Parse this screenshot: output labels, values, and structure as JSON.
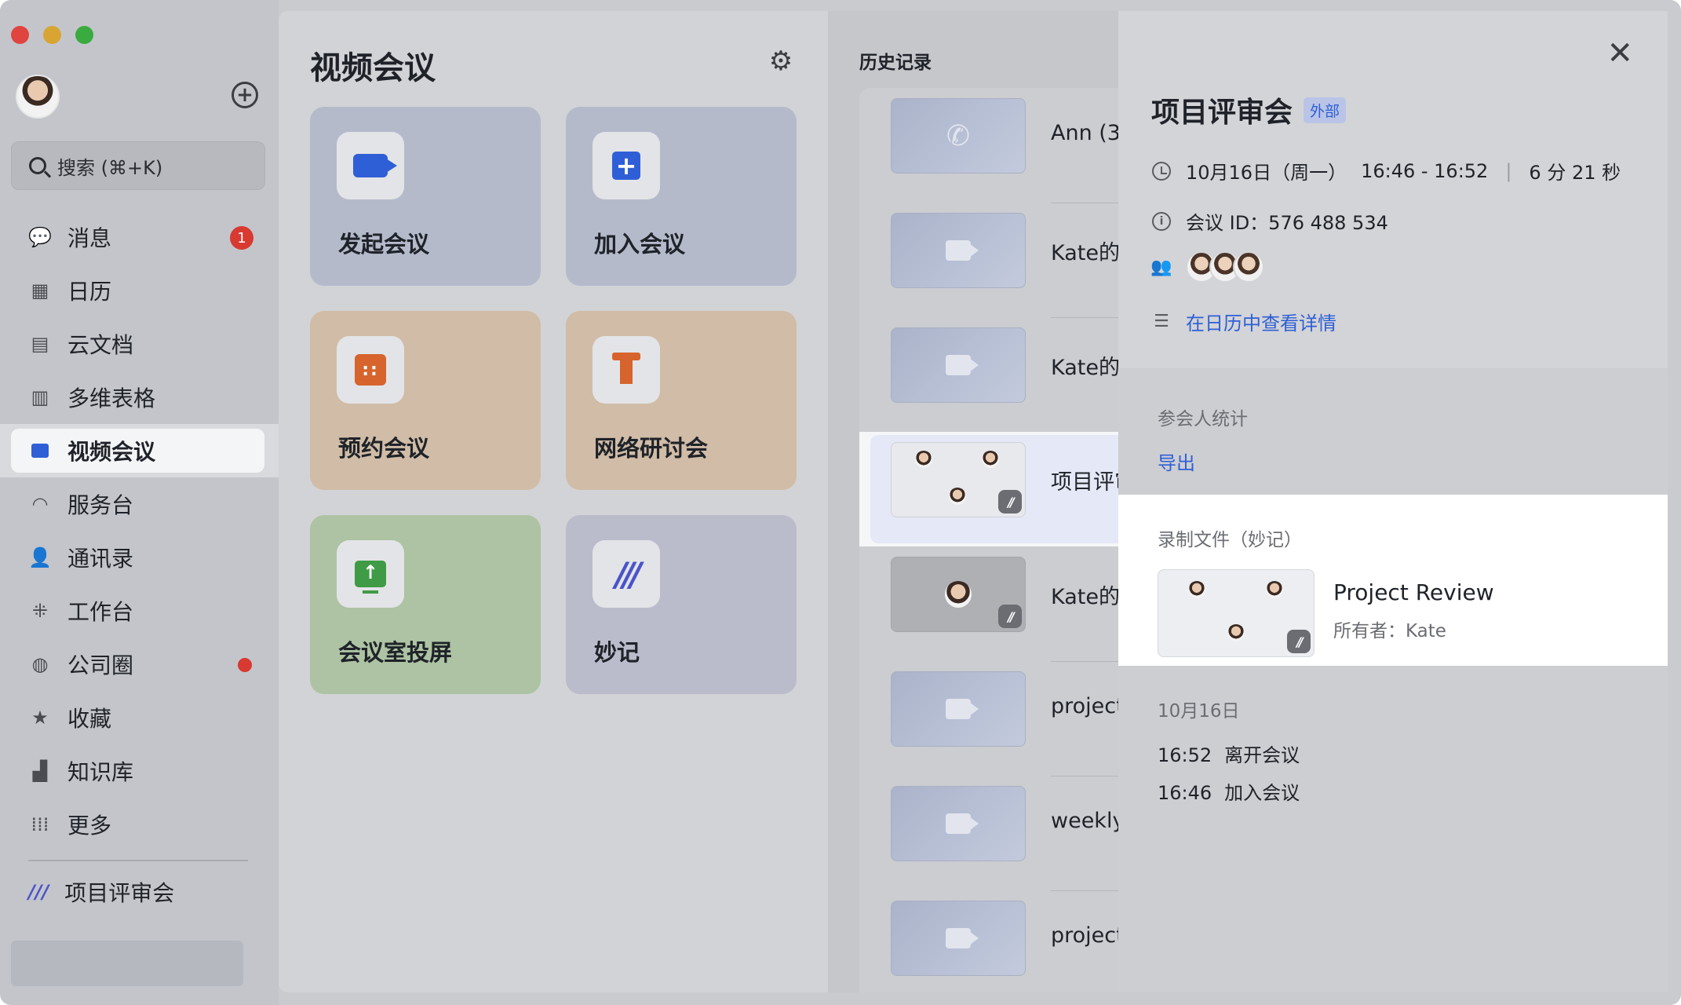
{
  "sidebar": {
    "search_placeholder": "搜索 (⌘+K)",
    "items": [
      {
        "label": "消息",
        "icon": "chat-bubbles-icon",
        "badge": "1"
      },
      {
        "label": "日历",
        "icon": "calendar-icon"
      },
      {
        "label": "云文档",
        "icon": "document-icon"
      },
      {
        "label": "多维表格",
        "icon": "table-icon"
      },
      {
        "label": "视频会议",
        "icon": "video-camera-icon",
        "active": true
      },
      {
        "label": "服务台",
        "icon": "headset-icon"
      },
      {
        "label": "通讯录",
        "icon": "contacts-icon"
      },
      {
        "label": "工作台",
        "icon": "apps-grid-icon"
      },
      {
        "label": "公司圈",
        "icon": "planet-icon",
        "dot": true
      },
      {
        "label": "收藏",
        "icon": "star-icon"
      },
      {
        "label": "知识库",
        "icon": "knowledge-base-icon"
      },
      {
        "label": "更多",
        "icon": "dots-grid-icon"
      }
    ],
    "pinned": {
      "label": "项目评审会",
      "icon": "miaoji-icon"
    }
  },
  "main": {
    "title": "视频会议",
    "cards": [
      {
        "label": "发起会议",
        "icon": "video-camera-icon",
        "color": "#b5bacb"
      },
      {
        "label": "加入会议",
        "icon": "plus-square-icon",
        "color": "#b5bacb"
      },
      {
        "label": "预约会议",
        "icon": "calendar-icon",
        "color": "#d0bca7"
      },
      {
        "label": "网络研讨会",
        "icon": "podium-icon",
        "color": "#d0bca7"
      },
      {
        "label": "会议室投屏",
        "icon": "screen-share-icon",
        "color": "#adc3a3"
      },
      {
        "label": "妙记",
        "icon": "miaoji-icon",
        "color": "#bbbccb"
      }
    ]
  },
  "history": {
    "title": "历史记录",
    "items": [
      {
        "name": "Ann (3"
      },
      {
        "name": "Kate的"
      },
      {
        "name": "Kate的"
      },
      {
        "name": "项目评审"
      },
      {
        "name": "Kate的"
      },
      {
        "name": "project"
      },
      {
        "name": "weekly"
      },
      {
        "name": "project"
      }
    ]
  },
  "detail": {
    "title": "项目评审会",
    "tag": "外部",
    "date": "10月16日（周一）",
    "time": "16:46 - 16:52",
    "duration": "6 分 21 秒",
    "meeting_id": "会议 ID：576 488 534",
    "calendar_link": "在日历中查看详情",
    "stats_label": "参会人统计",
    "export": "导出",
    "recording_label": "录制文件（妙记）",
    "recording_title": "Project Review",
    "recording_owner": "所有者：Kate",
    "log_date": "10月16日",
    "log": [
      {
        "time": "16:52",
        "event": "离开会议"
      },
      {
        "time": "16:46",
        "event": "加入会议"
      }
    ]
  },
  "colors": {
    "accent": "#2f5fd6",
    "badge_red": "#d83931"
  }
}
